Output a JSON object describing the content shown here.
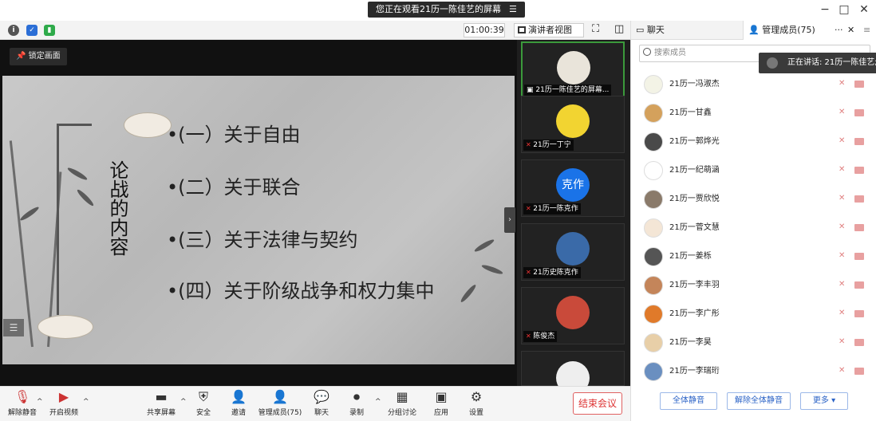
{
  "window": {
    "banner_text": "您正在观看21历一陈佳艺的屏幕",
    "banner_icon": "menu-icon",
    "minimize": "−",
    "maximize": "□",
    "close": "✕"
  },
  "toolbar": {
    "timer": "01:00:39",
    "view_label": "演讲者视图",
    "view_caret": "▾",
    "fullscreen_glyph": "⛶",
    "sidebar_glyph": "◫"
  },
  "share": {
    "lock_label": "锁定画面",
    "slide": {
      "side_title": "论战的内容",
      "bullets": [
        "•(一）关于自由",
        "•(二）关于联合",
        "•(三）关于法律与契约",
        "•(四）关于阶级战争和权力集中"
      ]
    },
    "collapse_glyph": "›"
  },
  "video_tiles": [
    {
      "name": "21历一陈佳艺的屏幕...",
      "avatar_color": "#e9e4da",
      "active": true
    },
    {
      "name": "21历一丁宁",
      "avatar_color": "#f2d431",
      "active": false
    },
    {
      "name": "21历一陈克作",
      "avatar_color": "#1a73e8",
      "avatar_text": "克作",
      "active": false
    },
    {
      "name": "21历史陈克作",
      "avatar_color": "#3a6aa8",
      "active": false
    },
    {
      "name": "陈俊杰",
      "avatar_color": "#c94a3a",
      "active": false
    },
    {
      "name": "",
      "avatar_color": "#eeeeee",
      "active": false
    }
  ],
  "panel": {
    "tab_chat": "聊天",
    "tab_members": "管理成员(75)",
    "tab_more": "···",
    "tab_close": "✕",
    "search_placeholder": "搜索成员",
    "speaking_text": "正在讲话: 21历一陈佳艺;",
    "members": [
      {
        "name": "21历一冯淑杰",
        "avatar_color": "#f3f3e6"
      },
      {
        "name": "21历一甘鑫",
        "avatar_color": "#d4a15c"
      },
      {
        "name": "21历一郭烨光",
        "avatar_color": "#4a4a4a"
      },
      {
        "name": "21历一纪萌涵",
        "avatar_color": "#ffffff"
      },
      {
        "name": "21历一贾欣悦",
        "avatar_color": "#8a7a6a"
      },
      {
        "name": "21历一菅文慧",
        "avatar_color": "#f4e6d6"
      },
      {
        "name": "21历一姜栎",
        "avatar_color": "#555555"
      },
      {
        "name": "21历一李丰羽",
        "avatar_color": "#c4855a"
      },
      {
        "name": "21历一李广彤",
        "avatar_color": "#e07a2a"
      },
      {
        "name": "21历一李昊",
        "avatar_color": "#e8cfa8"
      },
      {
        "name": "21历一李瑞珩",
        "avatar_color": "#6a8fc0"
      }
    ],
    "btn_mute_all": "全体静音",
    "btn_unmute_all": "解除全体静音",
    "btn_more": "更多 ▾"
  },
  "bottom": {
    "unmute": "解除静音",
    "video": "开启视频",
    "share": "共享屏幕",
    "security": "安全",
    "invite": "邀请",
    "members": "管理成员(75)",
    "chat": "聊天",
    "record": "录制",
    "breakout": "分组讨论",
    "apps": "应用",
    "settings": "设置",
    "end": "结束会议"
  },
  "colors": {
    "accent": "#2a62c6",
    "danger": "#d33333",
    "active_tile": "#3b9a3b"
  }
}
